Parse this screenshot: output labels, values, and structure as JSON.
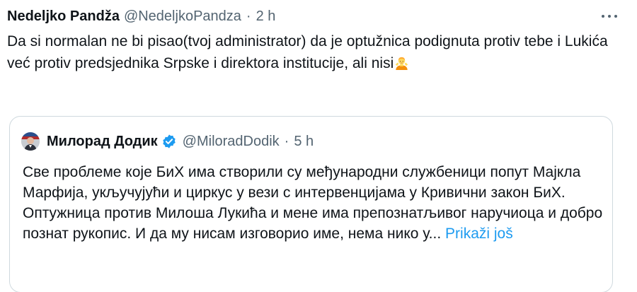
{
  "tweet": {
    "display_name": "Nedeljko Pandža",
    "handle": "@NedeljkoPandza",
    "separator": "·",
    "time": "2 h",
    "text": "Da si normalan ne bi pisao(tvoj administrator) da je optužnica podignuta protiv tebe i Lukića već protiv predsjednika Srpske i direktora institucije, ali nisi",
    "trailing_emoji": "person-shrugging-emoji"
  },
  "quoted_tweet": {
    "display_name": "Милорад Додик",
    "verified": true,
    "handle": "@MiloradDodik",
    "separator": "·",
    "time": "5 h",
    "text": "Све проблеме које БиХ има створили су међународни службеници попут Мајкла Марфија, укључујући и циркус у вези с интервенцијама у Кривични закон БиХ. Оптужница против Милоша Лукића и мене има препознатљивог наручиоца и добро познат рукопис. И да му нисам изговорио име, нема нико у...",
    "show_more": "Prikaži još"
  },
  "colors": {
    "text": "#0f1419",
    "secondary": "#536471",
    "link": "#1d9bf0",
    "border": "#cfd9de",
    "verified": "#1d9bf0"
  }
}
